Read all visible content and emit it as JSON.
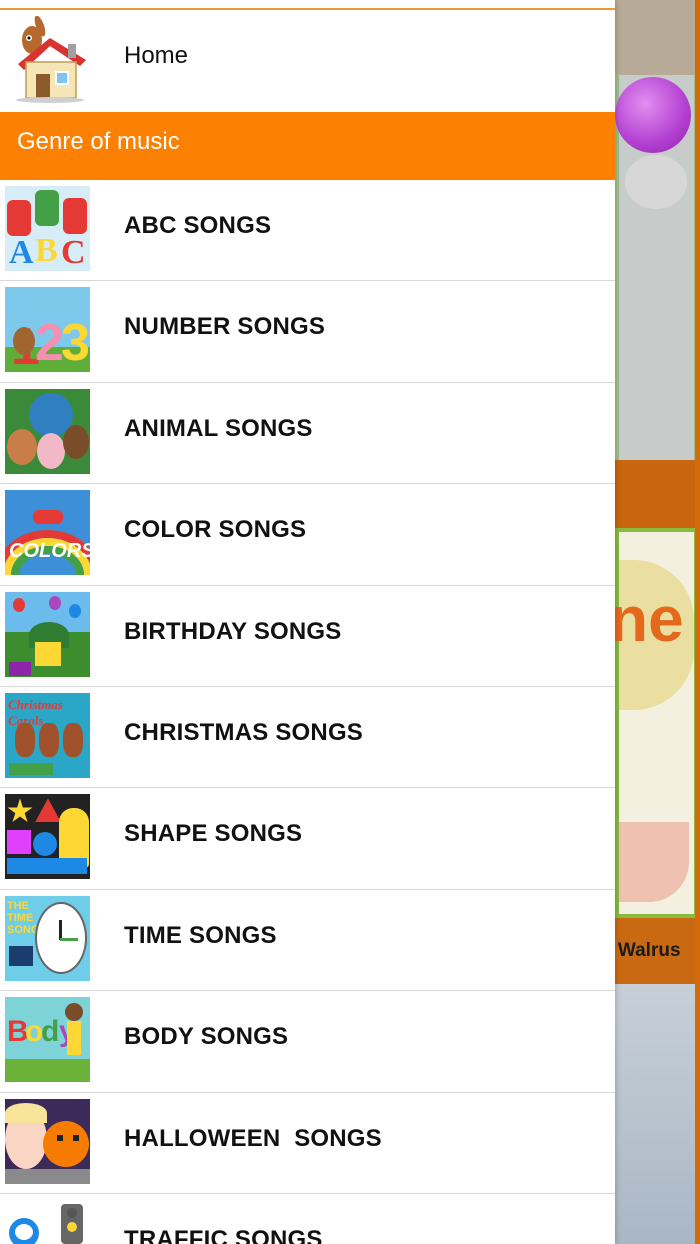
{
  "drawer": {
    "home_label": "Home",
    "section_title": "Genre of music",
    "items": [
      {
        "label": "ABC SONGS",
        "icon": "abc-songs-thumbnail"
      },
      {
        "label": "NUMBER SONGS",
        "icon": "number-songs-thumbnail"
      },
      {
        "label": "ANIMAL SONGS",
        "icon": "animal-songs-thumbnail"
      },
      {
        "label": "COLOR SONGS",
        "icon": "color-songs-thumbnail"
      },
      {
        "label": "BIRTHDAY SONGS",
        "icon": "birthday-songs-thumbnail"
      },
      {
        "label": "CHRISTMAS SONGS",
        "icon": "christmas-songs-thumbnail"
      },
      {
        "label": "SHAPE SONGS",
        "icon": "shape-songs-thumbnail"
      },
      {
        "label": "TIME SONGS",
        "icon": "time-songs-thumbnail"
      },
      {
        "label": "BODY SONGS",
        "icon": "body-songs-thumbnail"
      },
      {
        "label": "HALLOWEEN  SONGS",
        "icon": "halloween-songs-thumbnail"
      },
      {
        "label": "TRAFFIC SONGS",
        "icon": "traffic-songs-thumbnail"
      }
    ]
  },
  "background": {
    "partial_text": "g Walrus",
    "partial_title": "ne"
  },
  "colors": {
    "accent": "#fc8002",
    "text": "#111111",
    "divider": "#d9d9d9"
  }
}
